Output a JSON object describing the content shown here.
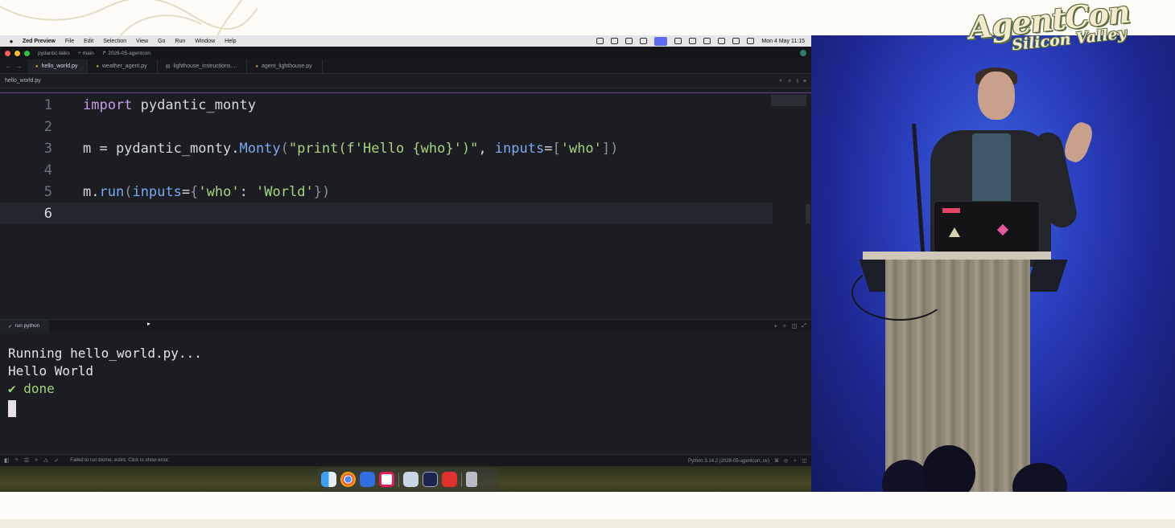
{
  "menubar": {
    "app_name": "Zed Preview",
    "items": [
      "File",
      "Edit",
      "Selection",
      "View",
      "Go",
      "Run",
      "Window",
      "Help"
    ],
    "clock": "Mon 4 May  11:15"
  },
  "titlebar": {
    "project": "pydantic-talks",
    "branch": "main",
    "folder": "2026-05-agentcon"
  },
  "tabs": [
    {
      "label": "hello_world.py",
      "active": true
    },
    {
      "label": "weather_agent.py",
      "active": false
    },
    {
      "label": "lighthouse_instructions....",
      "active": false
    },
    {
      "label": "agent_lighthouse.py",
      "active": false
    }
  ],
  "breadcrumb": "hello_world.py",
  "editor": {
    "line_numbers": [
      "1",
      "2",
      "3",
      "4",
      "5",
      "6"
    ],
    "current_line": 6
  },
  "terminal": {
    "tab_label": "run python",
    "lines": [
      "Running hello_world.py...",
      "Hello World",
      "✔ done"
    ]
  },
  "statusbar": {
    "message": "Failed to run biome, eslint. Click to show error.",
    "interpreter": "Python 3.14.2 (2026-05-agentcon; uv)"
  },
  "logo": {
    "line1": "AgentCon",
    "line2": "Silicon Valley"
  },
  "colors": {
    "editor_bg": "#1b1d22",
    "keyword": "#c89ee8",
    "function": "#7aa9f0",
    "string": "#a7d37e",
    "terminal_ok": "#9fd47a",
    "stage_bg": "#2a3fbf"
  },
  "dock": {
    "icons": [
      "finder-icon",
      "chrome-icon",
      "xcode-icon",
      "slack-icon",
      "preview-icon",
      "terminal-icon",
      "jetbrains-icon",
      "trash-icon"
    ]
  }
}
